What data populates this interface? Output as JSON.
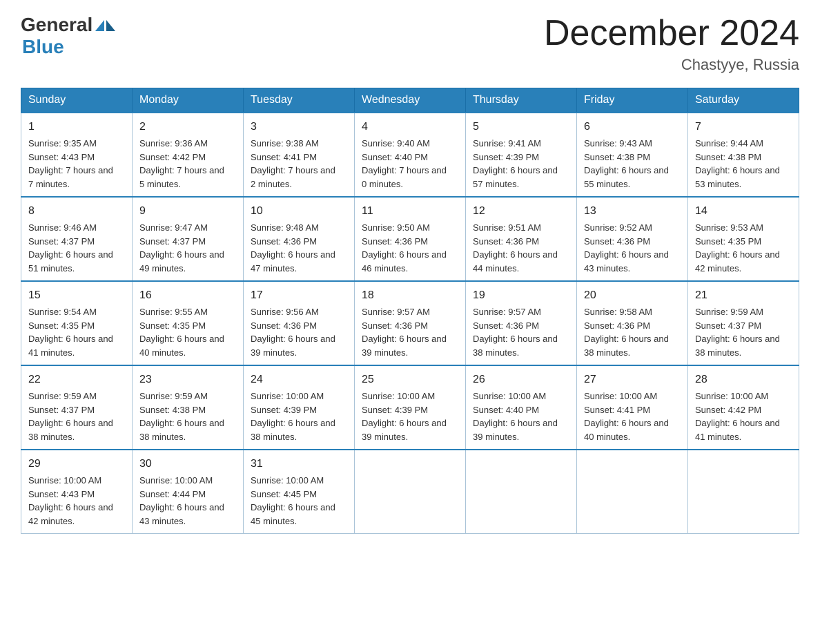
{
  "logo": {
    "general": "General",
    "blue": "Blue",
    "arrow": "▲"
  },
  "title": {
    "month": "December 2024",
    "location": "Chastyye, Russia"
  },
  "headers": [
    "Sunday",
    "Monday",
    "Tuesday",
    "Wednesday",
    "Thursday",
    "Friday",
    "Saturday"
  ],
  "weeks": [
    [
      {
        "day": "1",
        "sunrise": "9:35 AM",
        "sunset": "4:43 PM",
        "daylight": "7 hours and 7 minutes."
      },
      {
        "day": "2",
        "sunrise": "9:36 AM",
        "sunset": "4:42 PM",
        "daylight": "7 hours and 5 minutes."
      },
      {
        "day": "3",
        "sunrise": "9:38 AM",
        "sunset": "4:41 PM",
        "daylight": "7 hours and 2 minutes."
      },
      {
        "day": "4",
        "sunrise": "9:40 AM",
        "sunset": "4:40 PM",
        "daylight": "7 hours and 0 minutes."
      },
      {
        "day": "5",
        "sunrise": "9:41 AM",
        "sunset": "4:39 PM",
        "daylight": "6 hours and 57 minutes."
      },
      {
        "day": "6",
        "sunrise": "9:43 AM",
        "sunset": "4:38 PM",
        "daylight": "6 hours and 55 minutes."
      },
      {
        "day": "7",
        "sunrise": "9:44 AM",
        "sunset": "4:38 PM",
        "daylight": "6 hours and 53 minutes."
      }
    ],
    [
      {
        "day": "8",
        "sunrise": "9:46 AM",
        "sunset": "4:37 PM",
        "daylight": "6 hours and 51 minutes."
      },
      {
        "day": "9",
        "sunrise": "9:47 AM",
        "sunset": "4:37 PM",
        "daylight": "6 hours and 49 minutes."
      },
      {
        "day": "10",
        "sunrise": "9:48 AM",
        "sunset": "4:36 PM",
        "daylight": "6 hours and 47 minutes."
      },
      {
        "day": "11",
        "sunrise": "9:50 AM",
        "sunset": "4:36 PM",
        "daylight": "6 hours and 46 minutes."
      },
      {
        "day": "12",
        "sunrise": "9:51 AM",
        "sunset": "4:36 PM",
        "daylight": "6 hours and 44 minutes."
      },
      {
        "day": "13",
        "sunrise": "9:52 AM",
        "sunset": "4:36 PM",
        "daylight": "6 hours and 43 minutes."
      },
      {
        "day": "14",
        "sunrise": "9:53 AM",
        "sunset": "4:35 PM",
        "daylight": "6 hours and 42 minutes."
      }
    ],
    [
      {
        "day": "15",
        "sunrise": "9:54 AM",
        "sunset": "4:35 PM",
        "daylight": "6 hours and 41 minutes."
      },
      {
        "day": "16",
        "sunrise": "9:55 AM",
        "sunset": "4:35 PM",
        "daylight": "6 hours and 40 minutes."
      },
      {
        "day": "17",
        "sunrise": "9:56 AM",
        "sunset": "4:36 PM",
        "daylight": "6 hours and 39 minutes."
      },
      {
        "day": "18",
        "sunrise": "9:57 AM",
        "sunset": "4:36 PM",
        "daylight": "6 hours and 39 minutes."
      },
      {
        "day": "19",
        "sunrise": "9:57 AM",
        "sunset": "4:36 PM",
        "daylight": "6 hours and 38 minutes."
      },
      {
        "day": "20",
        "sunrise": "9:58 AM",
        "sunset": "4:36 PM",
        "daylight": "6 hours and 38 minutes."
      },
      {
        "day": "21",
        "sunrise": "9:59 AM",
        "sunset": "4:37 PM",
        "daylight": "6 hours and 38 minutes."
      }
    ],
    [
      {
        "day": "22",
        "sunrise": "9:59 AM",
        "sunset": "4:37 PM",
        "daylight": "6 hours and 38 minutes."
      },
      {
        "day": "23",
        "sunrise": "9:59 AM",
        "sunset": "4:38 PM",
        "daylight": "6 hours and 38 minutes."
      },
      {
        "day": "24",
        "sunrise": "10:00 AM",
        "sunset": "4:39 PM",
        "daylight": "6 hours and 38 minutes."
      },
      {
        "day": "25",
        "sunrise": "10:00 AM",
        "sunset": "4:39 PM",
        "daylight": "6 hours and 39 minutes."
      },
      {
        "day": "26",
        "sunrise": "10:00 AM",
        "sunset": "4:40 PM",
        "daylight": "6 hours and 39 minutes."
      },
      {
        "day": "27",
        "sunrise": "10:00 AM",
        "sunset": "4:41 PM",
        "daylight": "6 hours and 40 minutes."
      },
      {
        "day": "28",
        "sunrise": "10:00 AM",
        "sunset": "4:42 PM",
        "daylight": "6 hours and 41 minutes."
      }
    ],
    [
      {
        "day": "29",
        "sunrise": "10:00 AM",
        "sunset": "4:43 PM",
        "daylight": "6 hours and 42 minutes."
      },
      {
        "day": "30",
        "sunrise": "10:00 AM",
        "sunset": "4:44 PM",
        "daylight": "6 hours and 43 minutes."
      },
      {
        "day": "31",
        "sunrise": "10:00 AM",
        "sunset": "4:45 PM",
        "daylight": "6 hours and 45 minutes."
      },
      null,
      null,
      null,
      null
    ]
  ]
}
